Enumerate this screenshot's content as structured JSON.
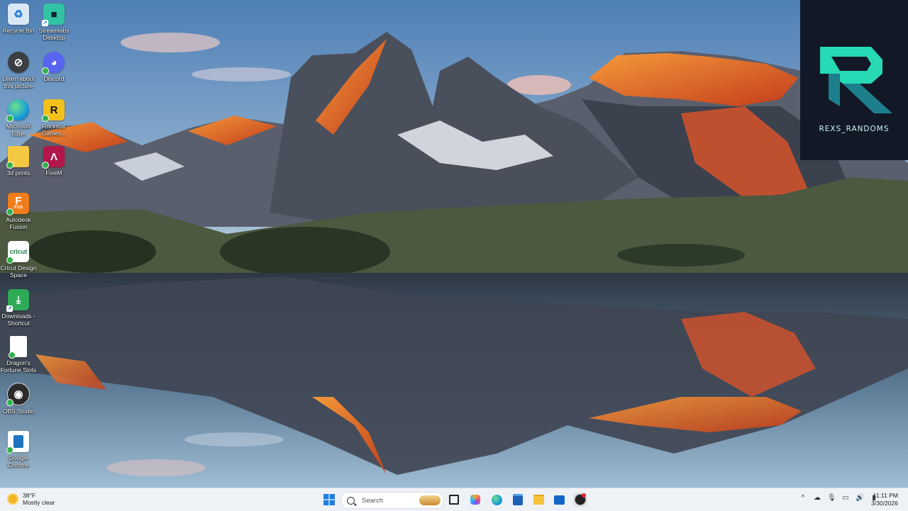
{
  "desktop": {
    "icons": [
      {
        "label": "Recycle Bin",
        "icon": "recycle-bin-icon",
        "color": "#cfe3f5"
      },
      {
        "label": "Streamlabs Desktop",
        "icon": "streamlabs-icon",
        "color": "#31c3a2"
      },
      {
        "label": "Learn about this picture",
        "icon": "learn-about-picture-icon",
        "color": "#3a3f44"
      },
      {
        "label": "Discord",
        "icon": "discord-icon",
        "color": "#5865f2"
      },
      {
        "label": "Microsoft Edge",
        "icon": "edge-icon",
        "color": "#1aa0d8"
      },
      {
        "label": "Rockstar Games...",
        "icon": "rockstar-icon",
        "color": "#f3c11b"
      },
      {
        "label": "3d prints",
        "icon": "folder-icon",
        "color": "#f5c842"
      },
      {
        "label": "FiveM",
        "icon": "fivem-icon",
        "color": "#b3164a"
      },
      {
        "label": "Autodesk Fusion",
        "icon": "autodesk-fusion-icon",
        "color": "#f07d1b"
      },
      {
        "label": "Cricut Design Space",
        "icon": "cricut-icon",
        "color": "#ffffff"
      },
      {
        "label": "Downloads - Shortcut",
        "icon": "downloads-icon",
        "color": "#2faa57"
      },
      {
        "label": "Dragon's Fortune Slots",
        "icon": "document-icon",
        "color": "#ffffff"
      },
      {
        "label": "OBS Studio",
        "icon": "obs-icon",
        "color": "#2b2b2b"
      },
      {
        "label": "Google Chrome",
        "icon": "chrome-shortcut-icon",
        "color": "#ffffff"
      }
    ],
    "icon_glyphs": {
      "streamlabs": "■",
      "discord": "◕",
      "rockstar": "R",
      "fivem": "Λ",
      "autodesk": "F",
      "autodesk_sub": "FUS",
      "cricut": "cricut",
      "obs": "◉"
    }
  },
  "brand": {
    "text": "REXS_RANDOMS",
    "colors": {
      "bg": "#121826",
      "accent": "#27d9b5",
      "accent2": "#1d7f8c"
    }
  },
  "taskbar": {
    "weather": {
      "temp": "38°F",
      "condition": "Mostly clear"
    },
    "search": {
      "placeholder": "Search"
    },
    "apps": [
      "task-view-icon",
      "copilot-icon",
      "edge-icon",
      "store-icon",
      "file-explorer-icon",
      "outlook-icon",
      "obs-icon"
    ],
    "tray": {
      "chevron": "^",
      "icons": [
        "network-icon",
        "microphone-icon",
        "display-icon",
        "speaker-icon"
      ]
    },
    "clock": {
      "time": "11:11 PM",
      "date": "3/30/2026"
    }
  },
  "colors": {
    "sky_top": "#5e8cc0",
    "sky_bottom": "#a7c3db",
    "rock": "#4a4f5c",
    "alpenglow": "#e2622a",
    "grass": "#4d5a3c"
  }
}
